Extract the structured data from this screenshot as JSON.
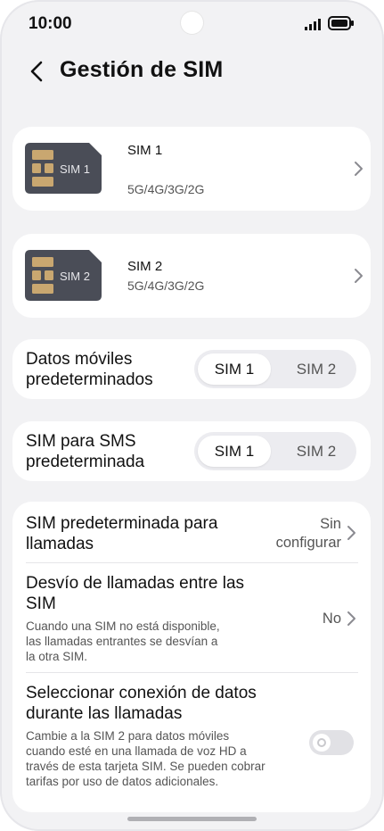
{
  "status": {
    "time": "10:00"
  },
  "header": {
    "title": "Gestión de SIM"
  },
  "sims": [
    {
      "chip_label": "SIM 1",
      "name": "SIM 1",
      "network": "5G/4G/3G/2G"
    },
    {
      "chip_label": "SIM 2",
      "name": "SIM 2",
      "network": "5G/4G/3G/2G"
    }
  ],
  "datos": {
    "label": "Datos móviles predeterminados",
    "options": [
      "SIM 1",
      "SIM 2"
    ],
    "selected": "SIM 1"
  },
  "sms": {
    "label": "SIM para SMS predeterminada",
    "options": [
      "SIM 1",
      "SIM 2"
    ],
    "selected": "SIM 1"
  },
  "calls": {
    "title": "SIM predeterminada para llamadas",
    "value": "Sin configurar"
  },
  "forwarding": {
    "title": "Desvío de llamadas entre las SIM",
    "description": "Cuando una SIM no está disponible, las llamadas entrantes se desvían a la otra SIM.",
    "value": "No"
  },
  "data_during_calls": {
    "title": "Seleccionar conexión de datos durante las llamadas",
    "description": "Cambie a la SIM 2 para datos móviles cuando esté en una llamada de voz HD a través de esta tarjeta SIM. Se pueden cobrar tarifas por uso de datos adicionales.",
    "enabled": false
  },
  "colors": {
    "background": "#f2f2f4",
    "card": "#ffffff",
    "chip": "#4a4d57",
    "chip_contacts": "#c9a770"
  }
}
